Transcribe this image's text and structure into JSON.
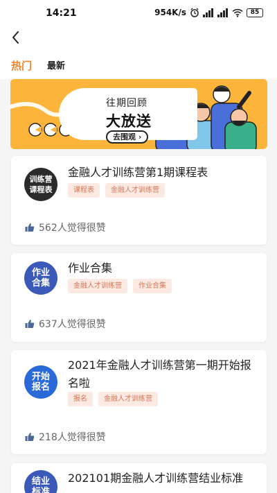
{
  "status_bar": {
    "time": "14:21",
    "speed": "954K/s",
    "network1": "HD",
    "network2": "HD",
    "battery": "85"
  },
  "tabs": [
    {
      "label": "热门"
    },
    {
      "label": "最新"
    }
  ],
  "banner": {
    "subtitle": "往期回顾",
    "headline": "大放送",
    "button_label": "去围观 ›"
  },
  "posts": [
    {
      "icon_text": "训练营 课程表",
      "title": "金融人才训练营第1期课程表",
      "tags": [
        "课程表",
        "金融人才训练营"
      ],
      "likes": "562人觉得很赞"
    },
    {
      "icon_text": "作业 合集",
      "title": "作业合集",
      "tags": [
        "金融人才训练营",
        "作业合集"
      ],
      "likes": "637人觉得很赞"
    },
    {
      "icon_text": "开始 报名",
      "title": "2021年金融人才训练营第一期开始报名啦",
      "tags": [
        "报名",
        "金融人才训练营"
      ],
      "likes": "218人觉得很赞"
    },
    {
      "icon_text": "结业 标准",
      "title": "202101期金融人才训练营结业标准",
      "tags": [],
      "likes": ""
    }
  ],
  "colors": {
    "accent": "#f0862e",
    "banner_bg": "#fcb53a",
    "tag_bg": "#fbe9e2",
    "tag_text": "#d3775a",
    "icon_dark": "#2b2b2b",
    "icon_blue": "#3a59b8",
    "icon_blue2": "#2a6ad8"
  }
}
